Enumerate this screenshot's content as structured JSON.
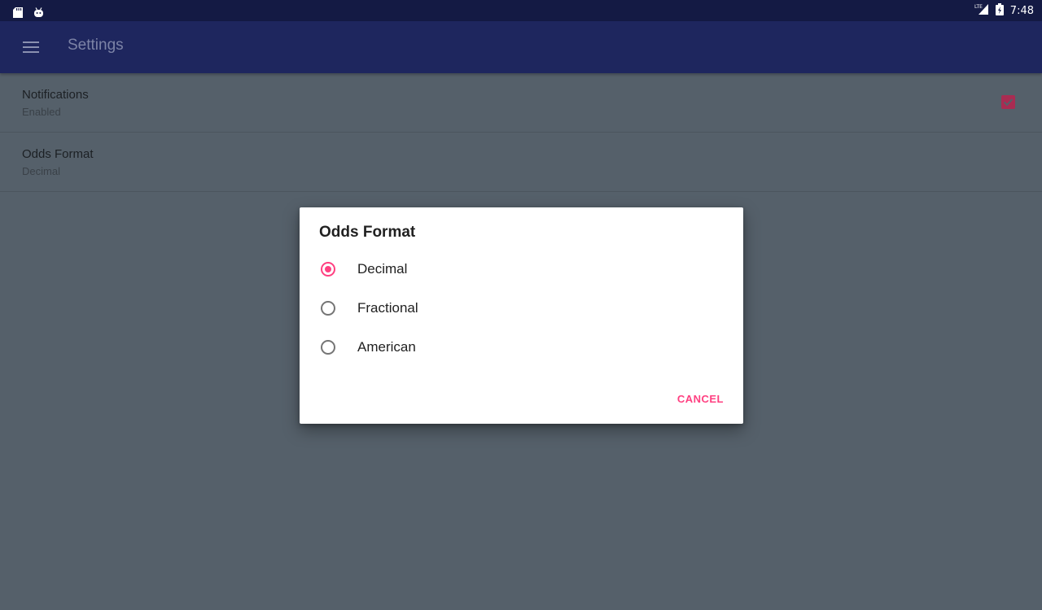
{
  "status_bar": {
    "left_icons": [
      "sd-card-icon",
      "android-robot-icon"
    ],
    "network_label": "LTE",
    "time": "7:48"
  },
  "app_bar": {
    "menu_icon": "hamburger-menu-icon",
    "title": "Settings"
  },
  "preferences": [
    {
      "title": "Notifications",
      "summary": "Enabled",
      "control": "checkbox",
      "checked": true
    },
    {
      "title": "Odds Format",
      "summary": "Decimal",
      "control": "list"
    }
  ],
  "dialog": {
    "title": "Odds Format",
    "options": [
      {
        "label": "Decimal",
        "selected": true
      },
      {
        "label": "Fractional",
        "selected": false
      },
      {
        "label": "American",
        "selected": false
      }
    ],
    "cancel_label": "CANCEL"
  },
  "colors": {
    "status_bar": "#141a44",
    "app_bar": "#1e265e",
    "scrim_background": "#55606a",
    "accent": "#ff4081",
    "checkbox": "#a92c52"
  }
}
